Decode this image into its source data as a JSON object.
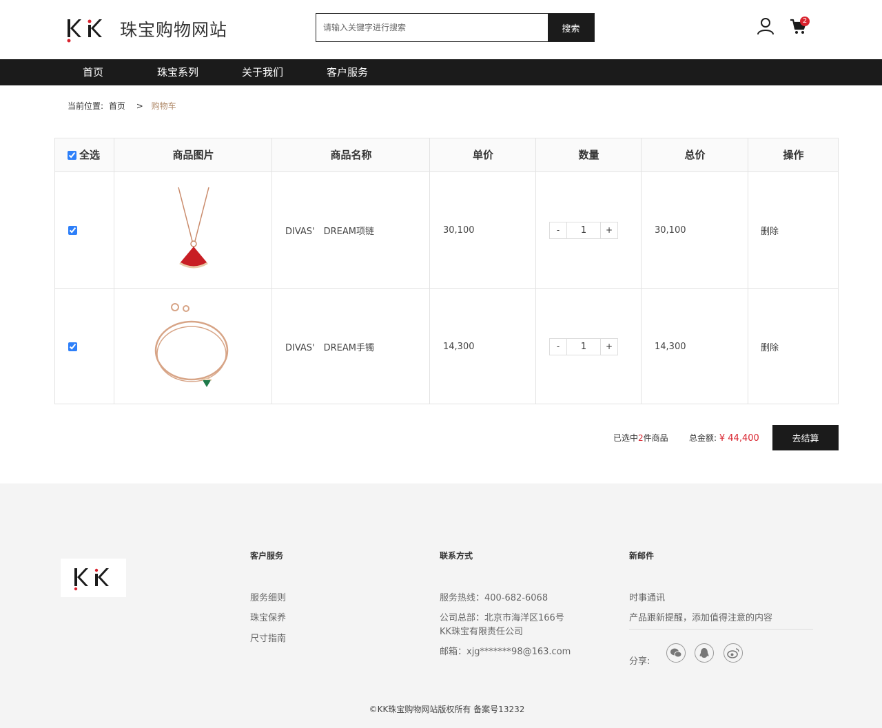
{
  "header": {
    "logo_text": "KK",
    "site_name": "珠宝购物网站",
    "search": {
      "placeholder": "请输入关键字进行搜索",
      "button_label": "搜索"
    },
    "cart_count": "2"
  },
  "nav": {
    "items": [
      {
        "label": "首页"
      },
      {
        "label": "珠宝系列"
      },
      {
        "label": "关于我们"
      },
      {
        "label": "客户服务"
      }
    ]
  },
  "breadcrumb": {
    "prefix": "当前位置:",
    "home": "首页",
    "separator": ">",
    "current": "购物车"
  },
  "cart": {
    "headers": {
      "select_all": "全选",
      "image": "商品图片",
      "name": "商品名称",
      "price": "单价",
      "quantity": "数量",
      "total": "总价",
      "action": "操作"
    },
    "items": [
      {
        "name": "DIVAS'　DREAM项链",
        "price": "30,100",
        "quantity": "1",
        "total": "30,100",
        "action": "删除",
        "checked": true,
        "image": "necklace-red-fan-pendant"
      },
      {
        "name": "DIVAS'　DREAM手镯",
        "price": "14,300",
        "quantity": "1",
        "total": "14,300",
        "action": "删除",
        "checked": true,
        "image": "bracelet-rose-gold-green-charm"
      }
    ],
    "qty_minus": "-",
    "qty_plus": "+"
  },
  "summary": {
    "selected_prefix": "已选中",
    "selected_count": "2",
    "selected_suffix": "件商品",
    "total_label": "总金额:",
    "total_amount": "¥ 44,400",
    "checkout_label": "去结算"
  },
  "footer": {
    "columns": [
      {
        "title": "客户服务",
        "links": [
          "服务细则",
          "珠宝保养",
          "尺寸指南"
        ]
      },
      {
        "title": "联系方式",
        "links": [
          "服务热线：400-682-6068",
          "公司总部：北京市海洋区166号",
          "KK珠宝有限责任公司",
          "邮箱：xjg*******98@163.com"
        ]
      },
      {
        "title": "新邮件",
        "links": [
          "时事通讯",
          "产品跟新提醒，添加值得注意的内容"
        ]
      }
    ],
    "share_label": "分享:",
    "share_icons": [
      "wechat-icon",
      "qq-icon",
      "weibo-icon"
    ],
    "copyright": "©KK珠宝购物网站版权所有 备案号13232"
  },
  "colors": {
    "accent_red": "#d9232e",
    "dark": "#1b1b1b",
    "breadcrumb_current": "#b08a6a",
    "footer_bg": "#f4f4f4"
  }
}
